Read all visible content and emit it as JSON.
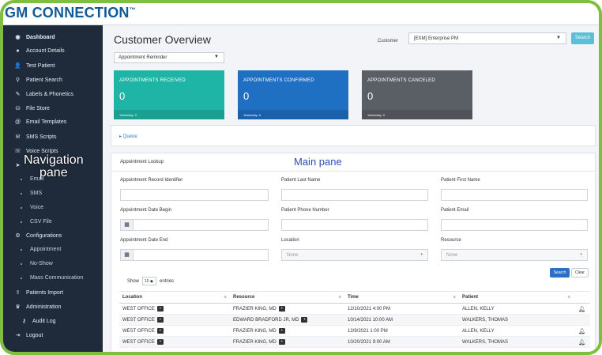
{
  "brand": {
    "name": "GM CONNECTION",
    "tm": "™"
  },
  "sidebar": {
    "items": [
      {
        "label": "Dashboard",
        "icon": "dashboard-icon",
        "glyph": "◉"
      },
      {
        "label": "Account Details",
        "icon": "info-icon",
        "glyph": "●"
      },
      {
        "label": "Test Patient",
        "icon": "user-plus-icon",
        "glyph": "👤"
      },
      {
        "label": "Patient Search",
        "icon": "search-icon",
        "glyph": "⚲"
      },
      {
        "label": "Labels & Phonetics",
        "icon": "pin-icon",
        "glyph": "✎"
      },
      {
        "label": "File Store",
        "icon": "database-icon",
        "glyph": "⛁"
      },
      {
        "label": "Email Templates",
        "icon": "email-icon",
        "glyph": "@"
      },
      {
        "label": "SMS Scripts",
        "icon": "chat-icon",
        "glyph": "✉"
      },
      {
        "label": "Voice Scripts",
        "icon": "phone-icon",
        "glyph": "☏"
      },
      {
        "label": "",
        "icon": "send-icon",
        "glyph": "➤"
      }
    ],
    "send_subs": [
      "Email",
      "SMS",
      "Voice",
      "CSV File"
    ],
    "configurations": {
      "label": "Configurations",
      "icon": "gears-icon",
      "glyph": "⚙"
    },
    "config_subs": [
      "Appointment",
      "No-Show",
      "Mass Communication"
    ],
    "bottom_items": [
      {
        "label": "Patients Import",
        "icon": "import-icon",
        "glyph": "⇪"
      },
      {
        "label": "Administration",
        "icon": "admin-icon",
        "glyph": "♛"
      },
      {
        "label": "Audit Log",
        "icon": "key-icon",
        "glyph": "⚷"
      },
      {
        "label": "Logout",
        "icon": "logout-icon",
        "glyph": "⇥"
      }
    ]
  },
  "annotations": {
    "nav_line1": "Navigation",
    "nav_line2": "pane",
    "main": "Main pane"
  },
  "header": {
    "title": "Customer Overview",
    "customer_label": "Customer",
    "customer_value": "[EXM] Enterprise PM",
    "search_label": "Search"
  },
  "report_select": "Appointment Reminder",
  "cards": [
    {
      "label": "APPOINTMENTS RECEIVED",
      "value": "0",
      "foot": "Yesterday: 0",
      "color": "#1fb5a6"
    },
    {
      "label": "APPOINTMENTS CONFIRMED",
      "value": "0",
      "foot": "Yesterday: 0",
      "color": "#1f6fc2"
    },
    {
      "label": "APPOINTMENTS CANCELED",
      "value": "0",
      "foot": "Yesterday: 0",
      "color": "#5a5f66"
    }
  ],
  "queue_label": "▸ Queue",
  "lookup": {
    "title": "Appointment Lookup",
    "fields": {
      "record_id": "Appointment Record Identifier",
      "last_name": "Patient Last Name",
      "first_name": "Patient First Name",
      "date_begin": "Appointment Date Begin",
      "phone": "Patient Phone Number",
      "email": "Patient Email",
      "date_end": "Appointment Date End",
      "location": "Location",
      "resource": "Resource"
    },
    "location_value": "None",
    "resource_value": "None",
    "show_label": "Show",
    "show_value": "10",
    "entries_label": "entries",
    "search_button": "Search",
    "clear_button": "Clear"
  },
  "table": {
    "headers": [
      "Location",
      "Resource",
      "Time",
      "Patient"
    ],
    "rows": [
      {
        "location": "WEST OFFICE",
        "resource": "FRAZIER KING, MD",
        "time": "12/10/2021 4:00 PM",
        "patient": "ALLEN, KELLY",
        "bell": true
      },
      {
        "location": "WEST OFFICE",
        "resource": "EDWARD BRADFORD JR, MD",
        "time": "10/14/2021 10:00 AM",
        "patient": "WALKERS, THOMAS",
        "bell": false
      },
      {
        "location": "WEST OFFICE",
        "resource": "FRAZIER KING, MD",
        "time": "12/9/2021 1:00 PM",
        "patient": "ALLEN, KELLY",
        "bell": true
      },
      {
        "location": "WEST OFFICE",
        "resource": "FRAZIER KING, MD",
        "time": "10/20/2021 9:00 AM",
        "patient": "WALKERS, THOMAS",
        "bell": true
      }
    ]
  }
}
